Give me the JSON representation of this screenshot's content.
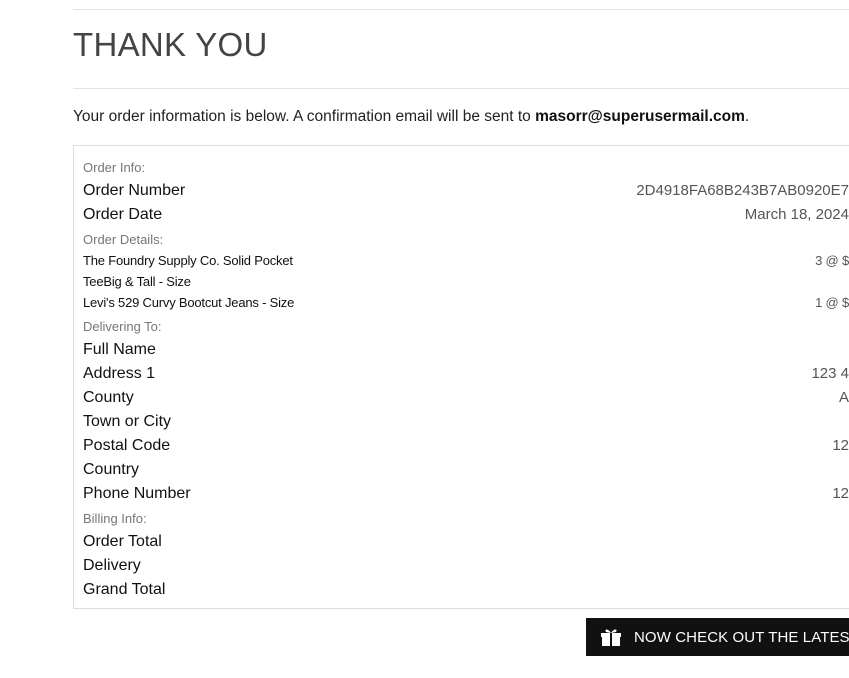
{
  "page": {
    "title": "THANK YOU",
    "intro_text": "Your order information is below. A confirmation email will be sent to ",
    "intro_email": "masorr@superusermail.com",
    "intro_end": "."
  },
  "order_info": {
    "section_label": "Order Info:",
    "order_number_label": "Order Number",
    "order_number_value": "2D4918FA68B243B7AB0920E7",
    "order_date_label": "Order Date",
    "order_date_value": "March 18, 2024"
  },
  "order_details": {
    "section_label": "Order Details:",
    "items": [
      {
        "name_line1": "The Foundry Supply Co. Solid Pocket",
        "name_line2": "TeeBig & Tall - Size",
        "qty": "3 @ $"
      },
      {
        "name_line1": "Levi's 529 Curvy Bootcut Jeans - Size",
        "qty": "1 @ $"
      }
    ]
  },
  "delivering_to": {
    "section_label": "Delivering To:",
    "full_name_label": "Full Name",
    "full_name_value": "",
    "address1_label": "Address 1",
    "address1_value": "123 4",
    "county_label": "County",
    "county_value": "A",
    "town_label": "Town or City",
    "town_value": "",
    "postal_label": "Postal Code",
    "postal_value": "12",
    "country_label": "Country",
    "country_value": "",
    "phone_label": "Phone Number",
    "phone_value": "12"
  },
  "billing_info": {
    "section_label": "Billing Info:",
    "order_total_label": "Order Total",
    "delivery_label": "Delivery",
    "grand_total_label": "Grand Total"
  },
  "cta": {
    "icon": "gift-icon",
    "label": "NOW CHECK OUT THE LATEST"
  }
}
